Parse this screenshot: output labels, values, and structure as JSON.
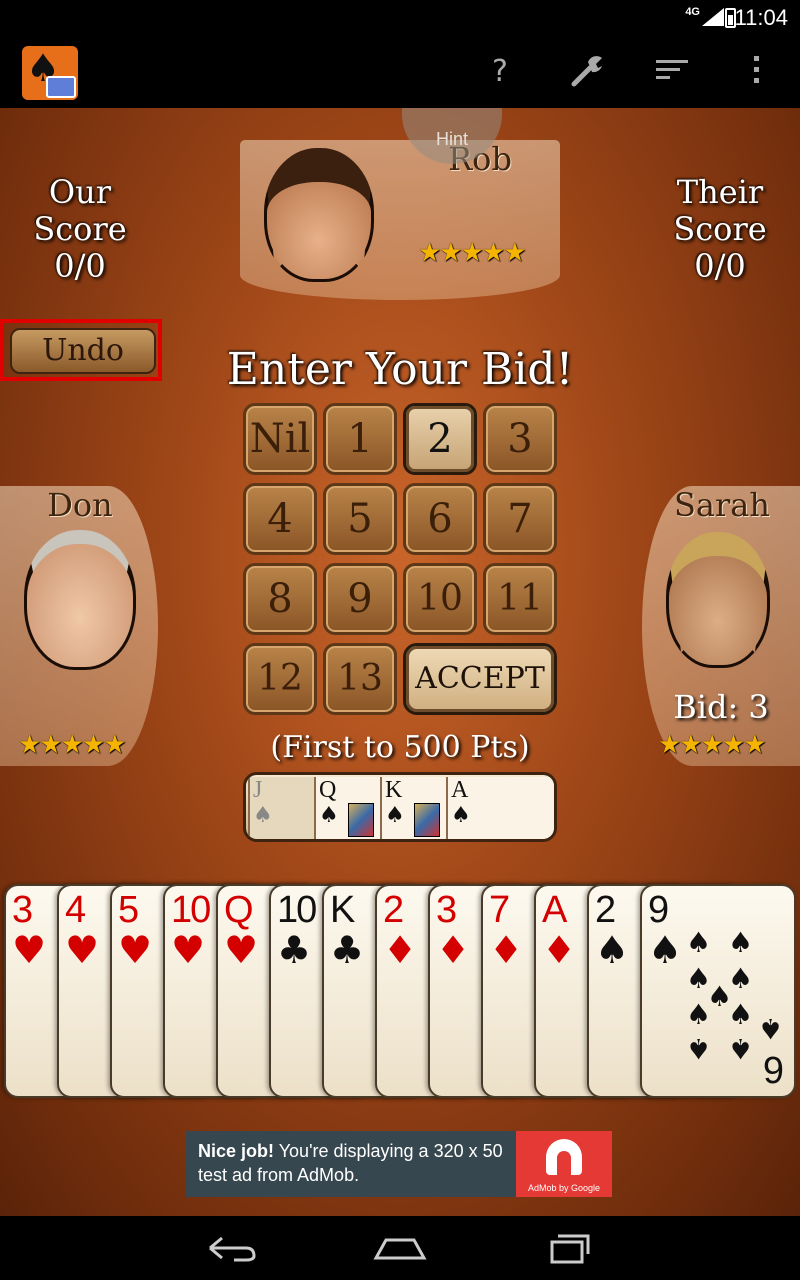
{
  "status": {
    "network": "4G",
    "time": "11:04"
  },
  "actionbar": {
    "icons": [
      "help-icon",
      "wrench-icon",
      "sort-icon",
      "overflow-menu-icon"
    ],
    "help_glyph": "?"
  },
  "hint": {
    "label": "Hint"
  },
  "scores": {
    "ours": {
      "label_line1": "Our",
      "label_line2": "Score",
      "value": "0/0"
    },
    "theirs": {
      "label_line1": "Their",
      "label_line2": "Score",
      "value": "0/0"
    }
  },
  "players": {
    "top": {
      "name": "Rob",
      "rating": "★★★★★"
    },
    "left": {
      "name": "Don",
      "rating": "★★★★★"
    },
    "right": {
      "name": "Sarah",
      "rating": "★★★★★",
      "bid": "Bid: 3"
    }
  },
  "undo": {
    "label": "Undo"
  },
  "bidding": {
    "title": "Enter Your Bid!",
    "options": [
      "Nil",
      "1",
      "2",
      "3",
      "4",
      "5",
      "6",
      "7",
      "8",
      "9",
      "10",
      "11",
      "12",
      "13"
    ],
    "selected": "2",
    "accept_label": "ACCEPT",
    "goal": "(First to 500 Pts)"
  },
  "trick_tray": [
    {
      "rank": "J",
      "suit": "♠"
    },
    {
      "rank": "Q",
      "suit": "♠"
    },
    {
      "rank": "K",
      "suit": "♠"
    },
    {
      "rank": "A",
      "suit": "♠"
    }
  ],
  "hand": [
    {
      "rank": "3",
      "suit": "♥",
      "color": "red"
    },
    {
      "rank": "4",
      "suit": "♥",
      "color": "red"
    },
    {
      "rank": "5",
      "suit": "♥",
      "color": "red"
    },
    {
      "rank": "10",
      "suit": "♥",
      "color": "red"
    },
    {
      "rank": "Q",
      "suit": "♥",
      "color": "red"
    },
    {
      "rank": "10",
      "suit": "♣",
      "color": "black"
    },
    {
      "rank": "K",
      "suit": "♣",
      "color": "black"
    },
    {
      "rank": "2",
      "suit": "♦",
      "color": "red"
    },
    {
      "rank": "3",
      "suit": "♦",
      "color": "red"
    },
    {
      "rank": "7",
      "suit": "♦",
      "color": "red"
    },
    {
      "rank": "A",
      "suit": "♦",
      "color": "red"
    },
    {
      "rank": "2",
      "suit": "♠",
      "color": "black"
    },
    {
      "rank": "9",
      "suit": "♠",
      "color": "black"
    }
  ],
  "hand_last_bottom_rank": "6",
  "ad": {
    "bold": "Nice job!",
    "text": " You're displaying a 320 x 50 test ad from AdMob.",
    "brand": "AdMob by Google"
  },
  "colors": {
    "board": "#a04718",
    "undo_highlight": "#e00000",
    "stars": "#f5b400"
  }
}
